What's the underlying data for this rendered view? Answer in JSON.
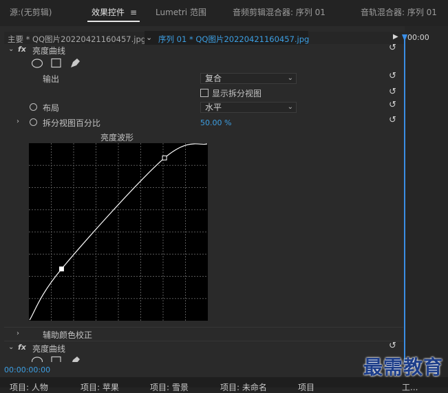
{
  "tabs": [
    {
      "label": "源:(无剪辑)"
    },
    {
      "label": "效果控件"
    },
    {
      "label": "Lumetri 范围"
    },
    {
      "label": "音频剪辑混合器: 序列 01"
    },
    {
      "label": "音轨混合器: 序列 01"
    }
  ],
  "menu_icon": "≡",
  "source": {
    "master_label": "主要 * QQ图片20220421160457.jpg",
    "sequence_label": "序列 01 * QQ图片20220421160457.jpg"
  },
  "timeline": {
    "timecode": "00:00"
  },
  "effect1": {
    "title": "亮度曲线",
    "output_label": "输出",
    "output_value": "复合",
    "split_view_label": "显示拆分视图",
    "layout_label": "布局",
    "layout_value": "水平",
    "split_percent_label": "拆分视图百分比",
    "split_percent_value": "50.00 %",
    "curve_title": "亮度波形",
    "curve_points": [
      [
        0,
        0
      ],
      [
        0.18,
        0.29
      ],
      [
        0.76,
        0.92
      ],
      [
        1,
        1
      ]
    ]
  },
  "secondary_label": "辅助颜色校正",
  "effect2": {
    "title": "亮度曲线"
  },
  "fx_label": "fx",
  "bottom": {
    "timecode": "00:00:00:00",
    "tabs": [
      "项目: 人物",
      "项目: 苹果",
      "项目: 雪景",
      "项目: 未命名",
      "项目",
      "工..."
    ]
  },
  "watermark": "最需教育",
  "colors": {
    "accent_blue": "#3d9fe3",
    "playhead": "#3a8ee6",
    "panel_bg": "#2a2a2a"
  }
}
